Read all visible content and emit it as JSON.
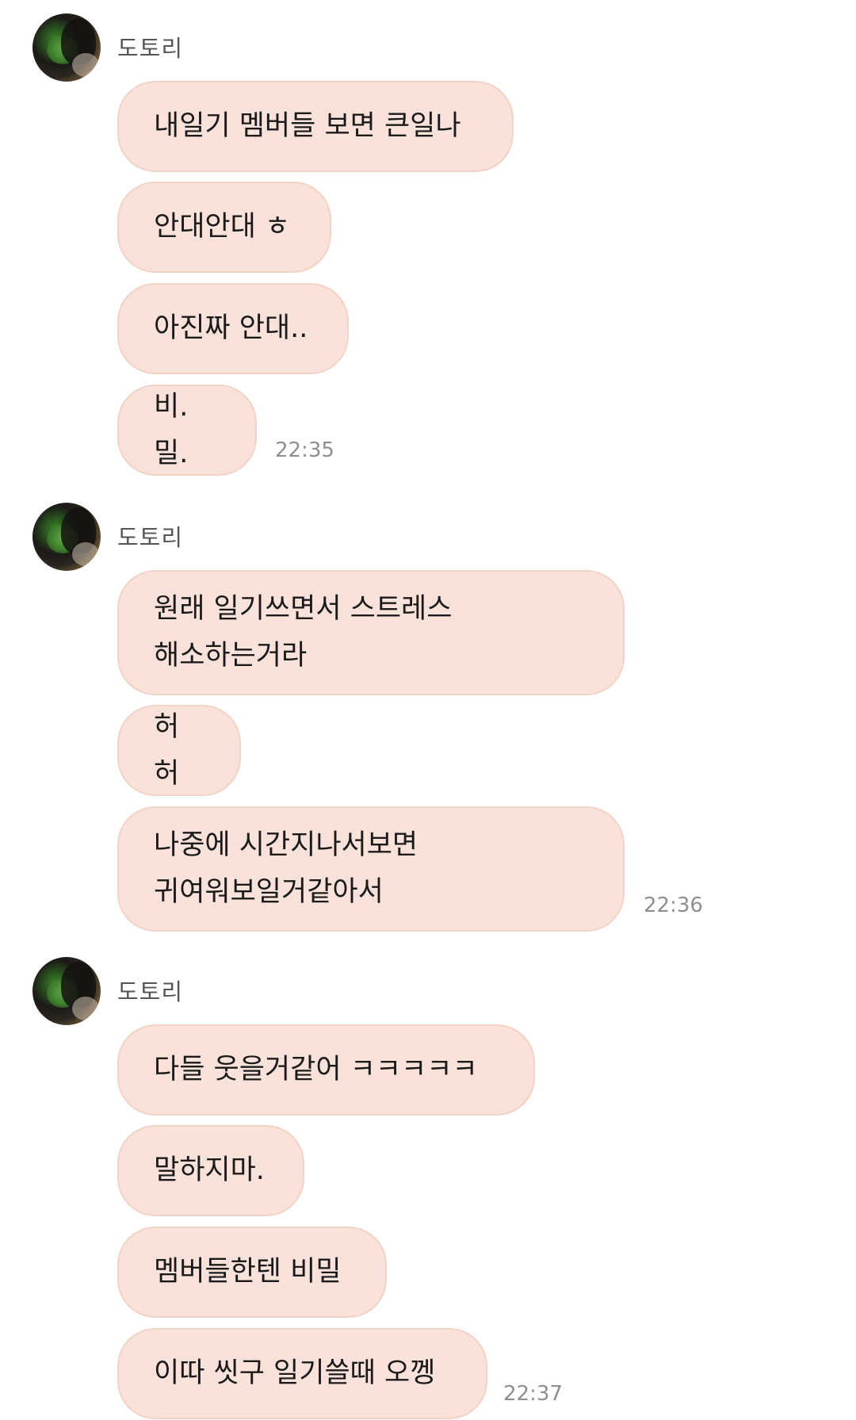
{
  "groups": [
    {
      "sender": "도토리",
      "messages": [
        "내일기 멤버들 보면 큰일나",
        "안대안대 ㅎ",
        "아진짜 안대..",
        "비.밀."
      ],
      "time": "22:35"
    },
    {
      "sender": "도토리",
      "messages": [
        "원래 일기쓰면서 스트레스\n해소하는거라",
        "허허",
        "나중에 시간지나서보면\n귀여워보일거같아서"
      ],
      "time": "22:36"
    },
    {
      "sender": "도토리",
      "messages": [
        "다들 웃을거같어 ㅋㅋㅋㅋㅋ",
        "말하지마.",
        "멤버들한텐 비밀",
        "이따 씻구 일기쓸때 오껭"
      ],
      "time": "22:37"
    }
  ],
  "colors": {
    "bubble_bg": "#f9e2d9",
    "bubble_border": "#f3d3c6",
    "time_text": "#8f8f8f",
    "sender_text": "#555555"
  },
  "icons": {
    "avatar": "profile-photo-avatar"
  }
}
